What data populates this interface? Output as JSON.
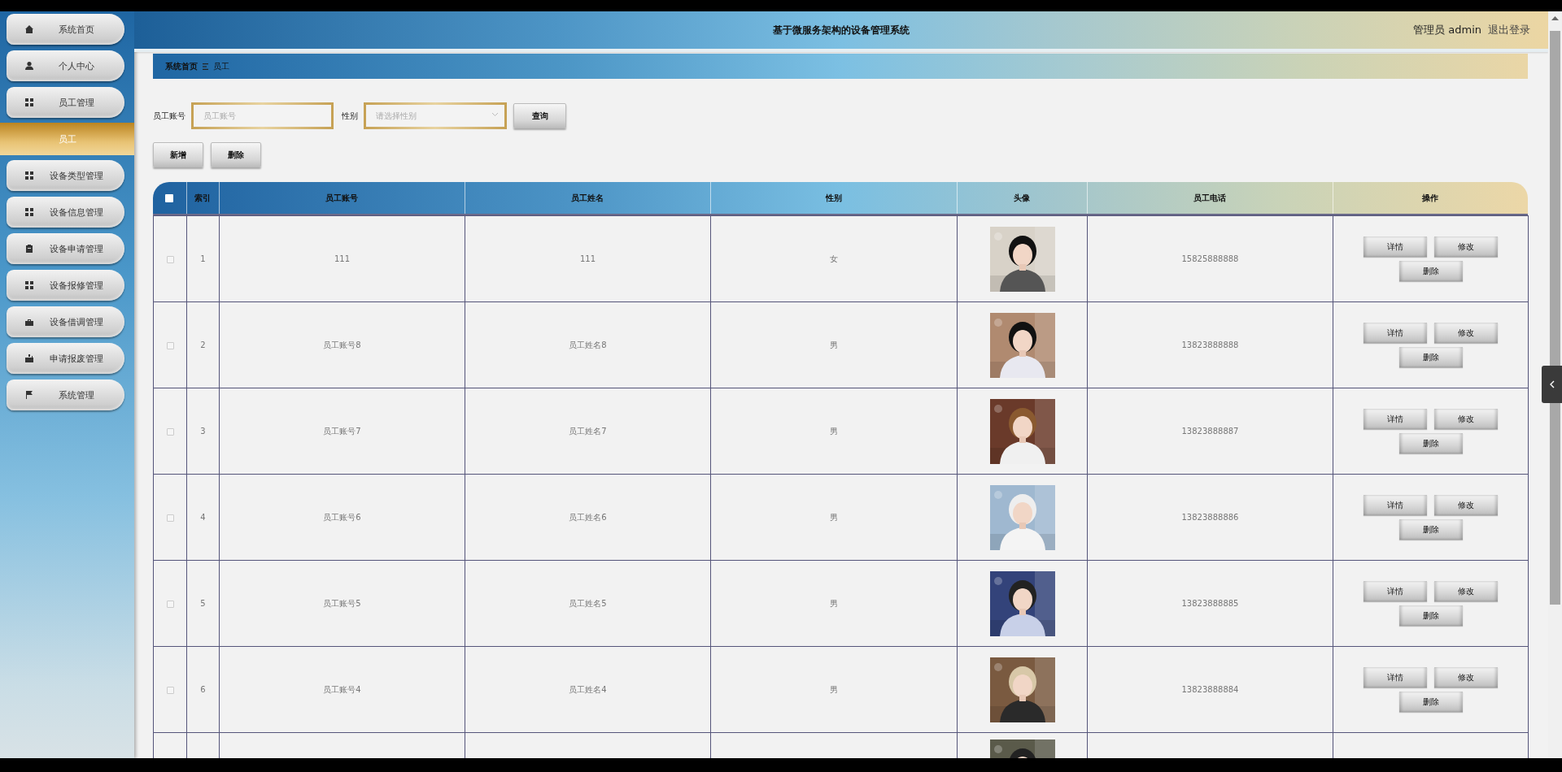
{
  "header": {
    "title": "基于微服务架构的设备管理系统",
    "user": "管理员 admin",
    "logout": "退出登录"
  },
  "sidebar": {
    "items": [
      {
        "label": "系统首页",
        "kind": "menu",
        "selected": false
      },
      {
        "label": "个人中心",
        "kind": "menu",
        "selected": false
      },
      {
        "label": "员工管理",
        "kind": "menu",
        "selected": false
      },
      {
        "label": "员工",
        "kind": "submenu",
        "selected": true
      },
      {
        "label": "设备类型管理",
        "kind": "menu",
        "selected": false
      },
      {
        "label": "设备信息管理",
        "kind": "menu",
        "selected": false
      },
      {
        "label": "设备申请管理",
        "kind": "menu",
        "selected": false
      },
      {
        "label": "设备报修管理",
        "kind": "menu",
        "selected": false
      },
      {
        "label": "设备借调管理",
        "kind": "menu",
        "selected": false
      },
      {
        "label": "申请报废管理",
        "kind": "menu",
        "selected": false
      },
      {
        "label": "系统管理",
        "kind": "menu",
        "selected": false
      }
    ]
  },
  "breadcrumb": [
    "系统首页",
    "员工"
  ],
  "filters": [
    {
      "label": "员工账号",
      "kind": "text",
      "placeholder": "员工账号"
    },
    {
      "label": "性别",
      "kind": "select",
      "placeholder": "请选择性别"
    }
  ],
  "search_button": "查询",
  "actions": [
    "新增",
    "删除"
  ],
  "table": {
    "select_all": {
      "checked": false
    },
    "columns": [
      "索引",
      "员工账号",
      "员工姓名",
      "性别",
      "头像",
      "员工电话",
      "操作"
    ],
    "rows": [
      {
        "checked": false,
        "index": "1",
        "account": "111",
        "name": "111",
        "gender": "女",
        "avatar": {
          "kind": "picture"
        },
        "phone": "15825888888",
        "buttons": [
          "详情",
          "修改",
          "删除"
        ]
      },
      {
        "checked": false,
        "index": "2",
        "account": "员工账号8",
        "name": "员工姓名8",
        "gender": "男",
        "avatar": {
          "kind": "picture"
        },
        "phone": "13823888888",
        "buttons": [
          "详情",
          "修改",
          "删除"
        ]
      },
      {
        "checked": false,
        "index": "3",
        "account": "员工账号7",
        "name": "员工姓名7",
        "gender": "男",
        "avatar": {
          "kind": "picture"
        },
        "phone": "13823888887",
        "buttons": [
          "详情",
          "修改",
          "删除"
        ]
      },
      {
        "checked": false,
        "index": "4",
        "account": "员工账号6",
        "name": "员工姓名6",
        "gender": "男",
        "avatar": {
          "kind": "picture"
        },
        "phone": "13823888886",
        "buttons": [
          "详情",
          "修改",
          "删除"
        ]
      },
      {
        "checked": false,
        "index": "5",
        "account": "员工账号5",
        "name": "员工姓名5",
        "gender": "男",
        "avatar": {
          "kind": "picture"
        },
        "phone": "13823888885",
        "buttons": [
          "详情",
          "修改",
          "删除"
        ]
      },
      {
        "checked": false,
        "index": "6",
        "account": "员工账号4",
        "name": "员工姓名4",
        "gender": "男",
        "avatar": {
          "kind": "picture"
        },
        "phone": "13823888884",
        "buttons": [
          "详情",
          "修改",
          "删除"
        ]
      },
      {
        "avatar": {
          "kind": "picture"
        }
      }
    ]
  }
}
